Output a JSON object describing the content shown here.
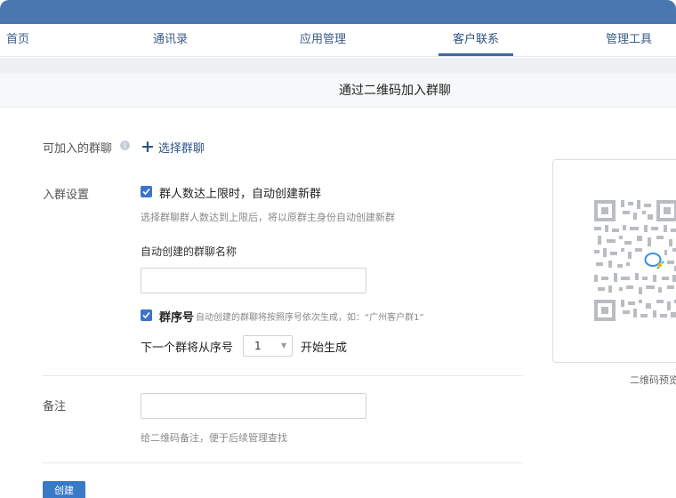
{
  "nav": {
    "items": [
      "首页",
      "通讯录",
      "应用管理",
      "客户联系",
      "管理工具"
    ],
    "active": "客户联系"
  },
  "page": {
    "title": "通过二维码加入群聊"
  },
  "form": {
    "group_label": "可加入的群聊",
    "select_group_label": "选择群聊",
    "settings_label": "入群设置",
    "auto_create_label": "群人数达上限时，自动创建新群",
    "auto_create_hint": "选择群聊群人数达到上限后，将以原群主身份自动创建新群",
    "auto_name_label": "自动创建的群聊名称",
    "auto_name_value": "",
    "serial_label": "群序号",
    "serial_hint": "自动创建的群聊将按照序号依次生成，如：“广州客户群1”",
    "next_serial_prefix": "下一个群将从序号",
    "next_serial_value": "1",
    "next_serial_suffix": "开始生成",
    "remark_label": "备注",
    "remark_value": "",
    "remark_hint": "给二维码备注，便于后续管理查找",
    "create_button": "创建"
  },
  "preview": {
    "caption": "二维码预览"
  },
  "colors": {
    "topbar": "#4a77b0",
    "accent": "#3a78c8",
    "link": "#2f5686"
  }
}
